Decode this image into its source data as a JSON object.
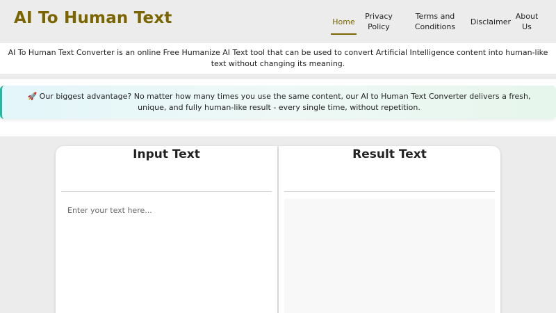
{
  "site": {
    "title": "AI To Human Text"
  },
  "nav": {
    "home": "Home",
    "privacy": "Privacy Policy",
    "terms": "Terms and Conditions",
    "disclaimer": "Disclaimer",
    "about": "About Us"
  },
  "intro": {
    "text": "AI To Human Text Converter is an online Free Humanize AI Text tool that can be used to convert Artificial Intelligence content into human-like text without changing its meaning."
  },
  "advantage": {
    "text": "🚀 Our biggest advantage? No matter how many times you use the same content, our AI to Human Text Converter delivers a fresh, unique, and fully human-like result - every single time, without repetition."
  },
  "input_panel": {
    "title": "Input Text",
    "placeholder": "Enter your text here...",
    "value": ""
  },
  "result_panel": {
    "title": "Result Text",
    "value": ""
  },
  "colors": {
    "brand": "#7a6500",
    "accent_border": "#2bb5a0",
    "background": "#ececec"
  }
}
